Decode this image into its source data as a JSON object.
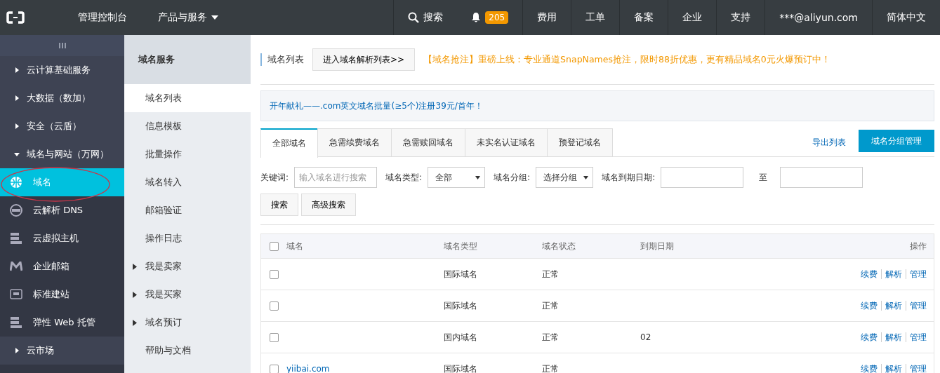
{
  "topbar": {
    "console": "管理控制台",
    "products": "产品与服务",
    "search": "搜索",
    "notifications": "205",
    "links": [
      "费用",
      "工单",
      "备案",
      "企业",
      "支持"
    ],
    "account": "***@aliyun.com",
    "language": "简体中文"
  },
  "sidebar": {
    "items": [
      {
        "label": "云计算基础服务",
        "kind": "group",
        "expanded": false,
        "selected": false
      },
      {
        "label": "大数据（数加）",
        "kind": "group",
        "expanded": false,
        "selected": false
      },
      {
        "label": "安全（云盾）",
        "kind": "group",
        "expanded": false,
        "selected": false
      },
      {
        "label": "域名与网站（万网）",
        "kind": "group",
        "expanded": true,
        "selected": false
      },
      {
        "label": "域名",
        "kind": "globe",
        "selected": true
      },
      {
        "label": "云解析 DNS",
        "kind": "dns",
        "selected": false
      },
      {
        "label": "云虚拟主机",
        "kind": "server",
        "selected": false
      },
      {
        "label": "企业邮箱",
        "kind": "mail",
        "selected": false
      },
      {
        "label": "标准建站",
        "kind": "monitor",
        "selected": false
      },
      {
        "label": "弹性 Web 托管",
        "kind": "server",
        "selected": false
      },
      {
        "label": "云市场",
        "kind": "group",
        "expanded": false,
        "selected": false
      }
    ]
  },
  "subnav": {
    "title": "域名服务",
    "items": [
      {
        "label": "域名列表",
        "selected": true,
        "has_children": false
      },
      {
        "label": "信息模板",
        "selected": false,
        "has_children": false
      },
      {
        "label": "批量操作",
        "selected": false,
        "has_children": false
      },
      {
        "label": "域名转入",
        "selected": false,
        "has_children": false
      },
      {
        "label": "邮箱验证",
        "selected": false,
        "has_children": false
      },
      {
        "label": "操作日志",
        "selected": false,
        "has_children": false
      },
      {
        "label": "我是卖家",
        "selected": false,
        "has_children": true
      },
      {
        "label": "我是买家",
        "selected": false,
        "has_children": true
      },
      {
        "label": "域名预订",
        "selected": false,
        "has_children": true
      },
      {
        "label": "帮助与文档",
        "selected": false,
        "has_children": false
      }
    ]
  },
  "header": {
    "title": "域名列表",
    "dns_button": "进入域名解析列表>>",
    "promo": "【域名抢注】重磅上线：专业通道SnapNames抢注，限时88折优惠，更有精品域名0元火爆预订中！"
  },
  "notice": "开年献礼——.com英文域名批量(≥5个)注册39元/首年！",
  "tabs": [
    {
      "label": "全部域名",
      "selected": true
    },
    {
      "label": "急需续费域名",
      "selected": false
    },
    {
      "label": "急需赎回域名",
      "selected": false
    },
    {
      "label": "未实名认证域名",
      "selected": false
    },
    {
      "label": "预登记域名",
      "selected": false
    }
  ],
  "export_link": "导出列表",
  "group_button": "域名分组管理",
  "filters": {
    "keyword_label": "关键词:",
    "keyword_placeholder": "输入域名进行搜索",
    "type_label": "域名类型:",
    "type_value": "全部",
    "group_label": "域名分组:",
    "group_value": "选择分组",
    "date_label": "域名到期日期:",
    "to": "至"
  },
  "search_buttons": [
    "搜索",
    "高级搜索"
  ],
  "table": {
    "all_checked": false,
    "columns": [
      "域名",
      "域名类型",
      "域名状态",
      "到期日期",
      "操作"
    ],
    "rows": [
      {
        "checked": false,
        "type": "国际域名",
        "status": "正常",
        "actions": [
          "续费",
          "解析",
          "管理"
        ]
      },
      {
        "checked": false,
        "type": "国际域名",
        "status": "正常",
        "actions": [
          "续费",
          "解析",
          "管理"
        ]
      },
      {
        "checked": false,
        "type": "国内域名",
        "status": "正常",
        "expiry": "02",
        "actions": [
          "续费",
          "解析",
          "管理"
        ]
      },
      {
        "checked": false,
        "domain": "yiibai.com",
        "type": "国际域名",
        "status": "正常",
        "actions": [
          "续费",
          "解析",
          "管理"
        ]
      }
    ]
  }
}
